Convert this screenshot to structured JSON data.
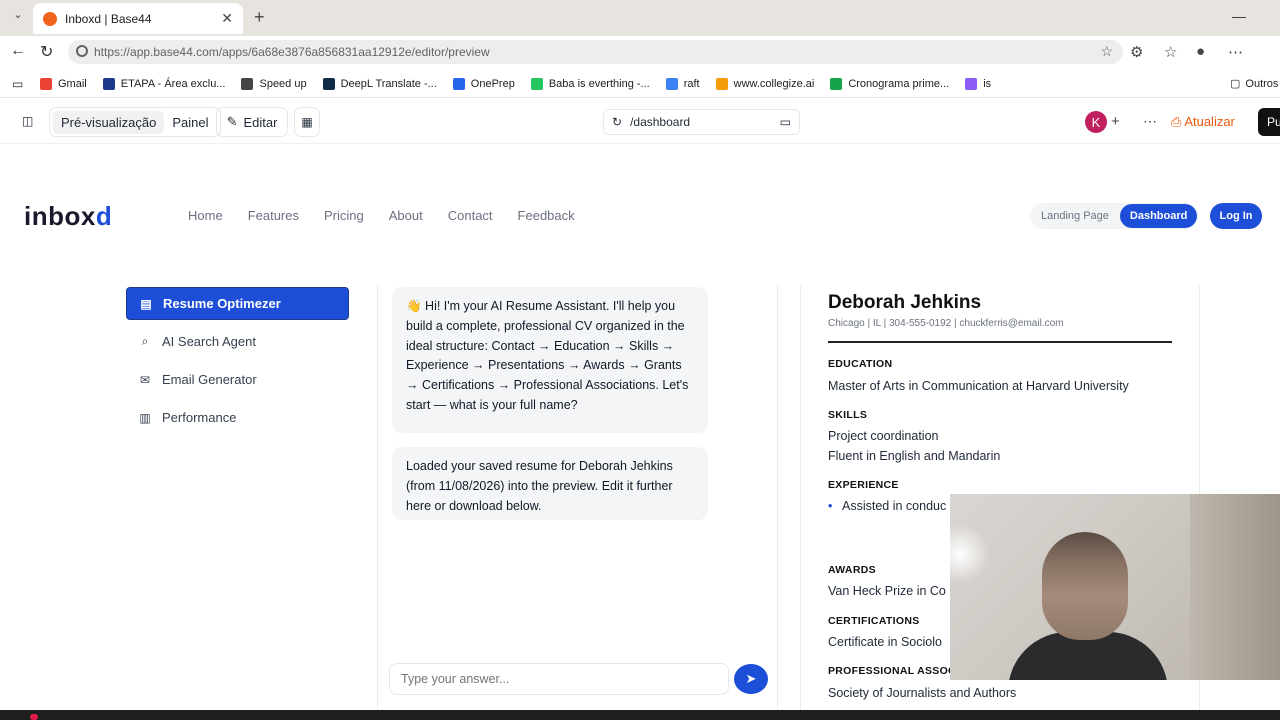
{
  "browser": {
    "tab_title": "Inboxd | Base44",
    "url": "https://app.base44.com/apps/6a68e3876a856831aa12912e/editor/preview",
    "bookmarks": [
      {
        "label": "Gmail",
        "color": "#ea4335"
      },
      {
        "label": "ETAPA - Área exclu...",
        "color": "#1e3a8a"
      },
      {
        "label": "Speed up",
        "color": "#444444"
      },
      {
        "label": "DeepL Translate -...",
        "color": "#0f2b46"
      },
      {
        "label": "OnePrep",
        "color": "#2563eb"
      },
      {
        "label": "Baba is everthing -...",
        "color": "#22c55e"
      },
      {
        "label": "raft",
        "color": "#3b82f6"
      },
      {
        "label": "www.collegize.ai",
        "color": "#f59e0b"
      },
      {
        "label": "Cronograma prime...",
        "color": "#16a34a"
      },
      {
        "label": "is",
        "color": "#8b5cf6"
      }
    ],
    "other_bookmarks": "Outros"
  },
  "editor": {
    "preview_label": "Pré-visualização",
    "panel_label": "Painel",
    "edit_label": "Editar",
    "route": "/dashboard",
    "avatar_initial": "K",
    "update_label": "Atualizar",
    "publish_label": "Pu"
  },
  "app": {
    "logo_main": "inbox",
    "logo_accent": "d",
    "nav": [
      "Home",
      "Features",
      "Pricing",
      "About",
      "Contact",
      "Feedback"
    ],
    "toggle_landing": "Landing Page",
    "toggle_dashboard": "Dashboard",
    "login": "Log In",
    "accent": "#1d4ed8"
  },
  "sidebar": {
    "items": [
      {
        "label": "Resume Optimezer",
        "icon": "document-icon",
        "active": true
      },
      {
        "label": "AI Search Agent",
        "icon": "search-icon"
      },
      {
        "label": "Email Generator",
        "icon": "mail-icon"
      },
      {
        "label": "Performance",
        "icon": "bar-chart-icon"
      }
    ]
  },
  "chat": {
    "messages": [
      "👋 Hi! I'm your AI Resume Assistant. I'll help you build a complete, professional CV organized in the ideal structure: Contact → Education → Skills → Experience → Presentations → Awards → Grants → Certifications → Professional Associations. Let's start — what is your full name?",
      "Loaded your saved resume for Deborah Jehkins (from 11/08/2026) into the preview. Edit it further here or download below."
    ],
    "input_placeholder": "Type your answer..."
  },
  "resume": {
    "name": "Deborah Jehkins",
    "contact": "Chicago | IL | 304-555-0192 | chuckferris@email.com",
    "education_heading": "EDUCATION",
    "education": "Master of Arts in Communication at Harvard University",
    "skills_heading": "SKILLS",
    "skills": [
      "Project coordination",
      "Fluent in English and Mandarin"
    ],
    "experience_heading": "EXPERIENCE",
    "experience_bullet": "Assisted in conduc University, collabo interpret results.",
    "awards_heading": "AWARDS",
    "awards": "Van Heck Prize in Co",
    "certifications_heading": "CERTIFICATIONS",
    "certifications": "Certificate in Sociolo",
    "associations_heading": "PROFESSIONAL ASSOC",
    "associations": "Society of Journalists and Authors"
  }
}
